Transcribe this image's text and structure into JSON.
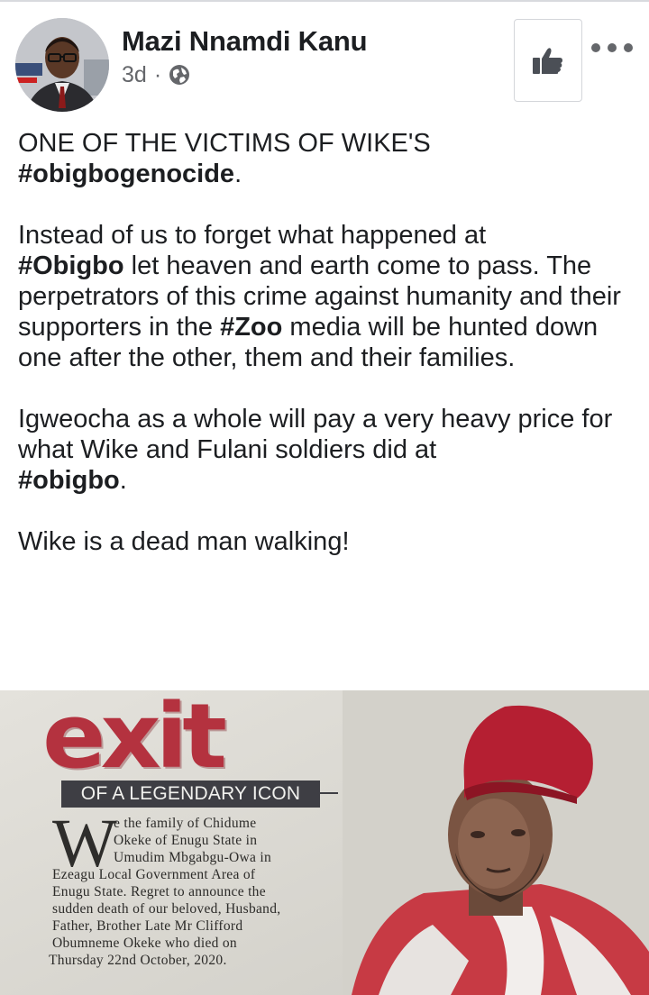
{
  "post": {
    "author": "Mazi Nnamdi Kanu",
    "time": "3d",
    "separator": "·",
    "body": {
      "p1": {
        "text": "ONE OF THE VICTIMS OF WIKE'S",
        "tag": "#obigbogenocide",
        "end": "."
      },
      "p2": {
        "a": "Instead of us to forget what happened at",
        "tag1": "#Obigbo",
        "b": " let heaven and earth come to pass. The perpetrators of this crime against humanity and their supporters in the ",
        "tag2": "#Zoo",
        "c": " media will be hunted down one after the other, them and their families."
      },
      "p3": {
        "a": "Igweocha as a whole will pay a very heavy price for what Wike and Fulani soldiers did at",
        "tag": "#obigbo",
        "end": "."
      },
      "p4": "Wike is a dead man walking!"
    }
  },
  "attached_image": {
    "headline": "exit",
    "banner": "OF A LEGENDARY ICON",
    "dropcap": "W",
    "lines": [
      "e the family of Chidume",
      "Okeke of Enugu State in",
      "Umudim Mbgabgu-Owa in",
      "Ezeagu Local Government Area of",
      "Enugu State. Regret to announce the",
      "sudden death of our beloved, Husband,",
      "Father, Brother Late Mr Clifford",
      "Obumneme Okeke who died on",
      "Thursday 22nd October, 2020."
    ]
  },
  "icons": {
    "like": "thumbs-up-icon",
    "more": "more-options-icon",
    "audience": "globe-icon"
  },
  "colors": {
    "text": "#1c1e21",
    "muted": "#65676b",
    "headline_red": "#b4323f"
  }
}
